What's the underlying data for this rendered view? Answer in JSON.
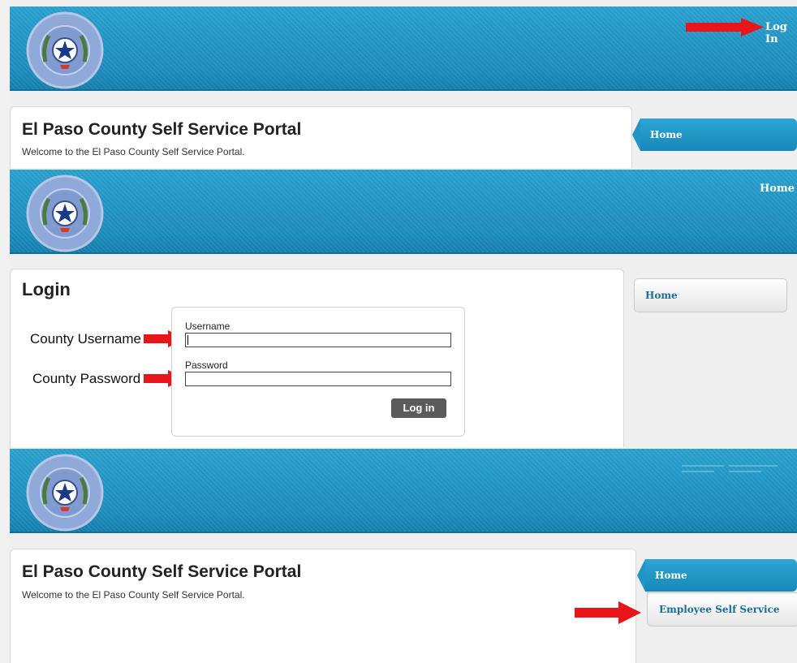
{
  "panel1": {
    "header_link": "Log In",
    "title": "El Paso County Self Service Portal",
    "welcome": "Welcome to the El Paso County Self Service Portal.",
    "nav_home": "Home"
  },
  "panel2": {
    "header_link": "Home",
    "login_title": "Login",
    "side_username": "County Username",
    "side_password": "County Password",
    "username_label": "Username",
    "password_label": "Password",
    "login_button": "Log in",
    "nav_home": "Home"
  },
  "panel3": {
    "title": "El Paso County Self Service Portal",
    "welcome": "Welcome to the El Paso County Self Service Portal.",
    "nav_home": "Home",
    "nav_employee": "Employee Self Service"
  },
  "seal_text": {
    "top": "THE COUNTY OF EL PASO",
    "bottom": "TEXAS"
  },
  "colors": {
    "banner": "#1f96c6",
    "arrow": "#e8161b",
    "button": "#5b5b5b"
  },
  "icons": [
    "county-seal-icon",
    "red-arrow-icon"
  ]
}
